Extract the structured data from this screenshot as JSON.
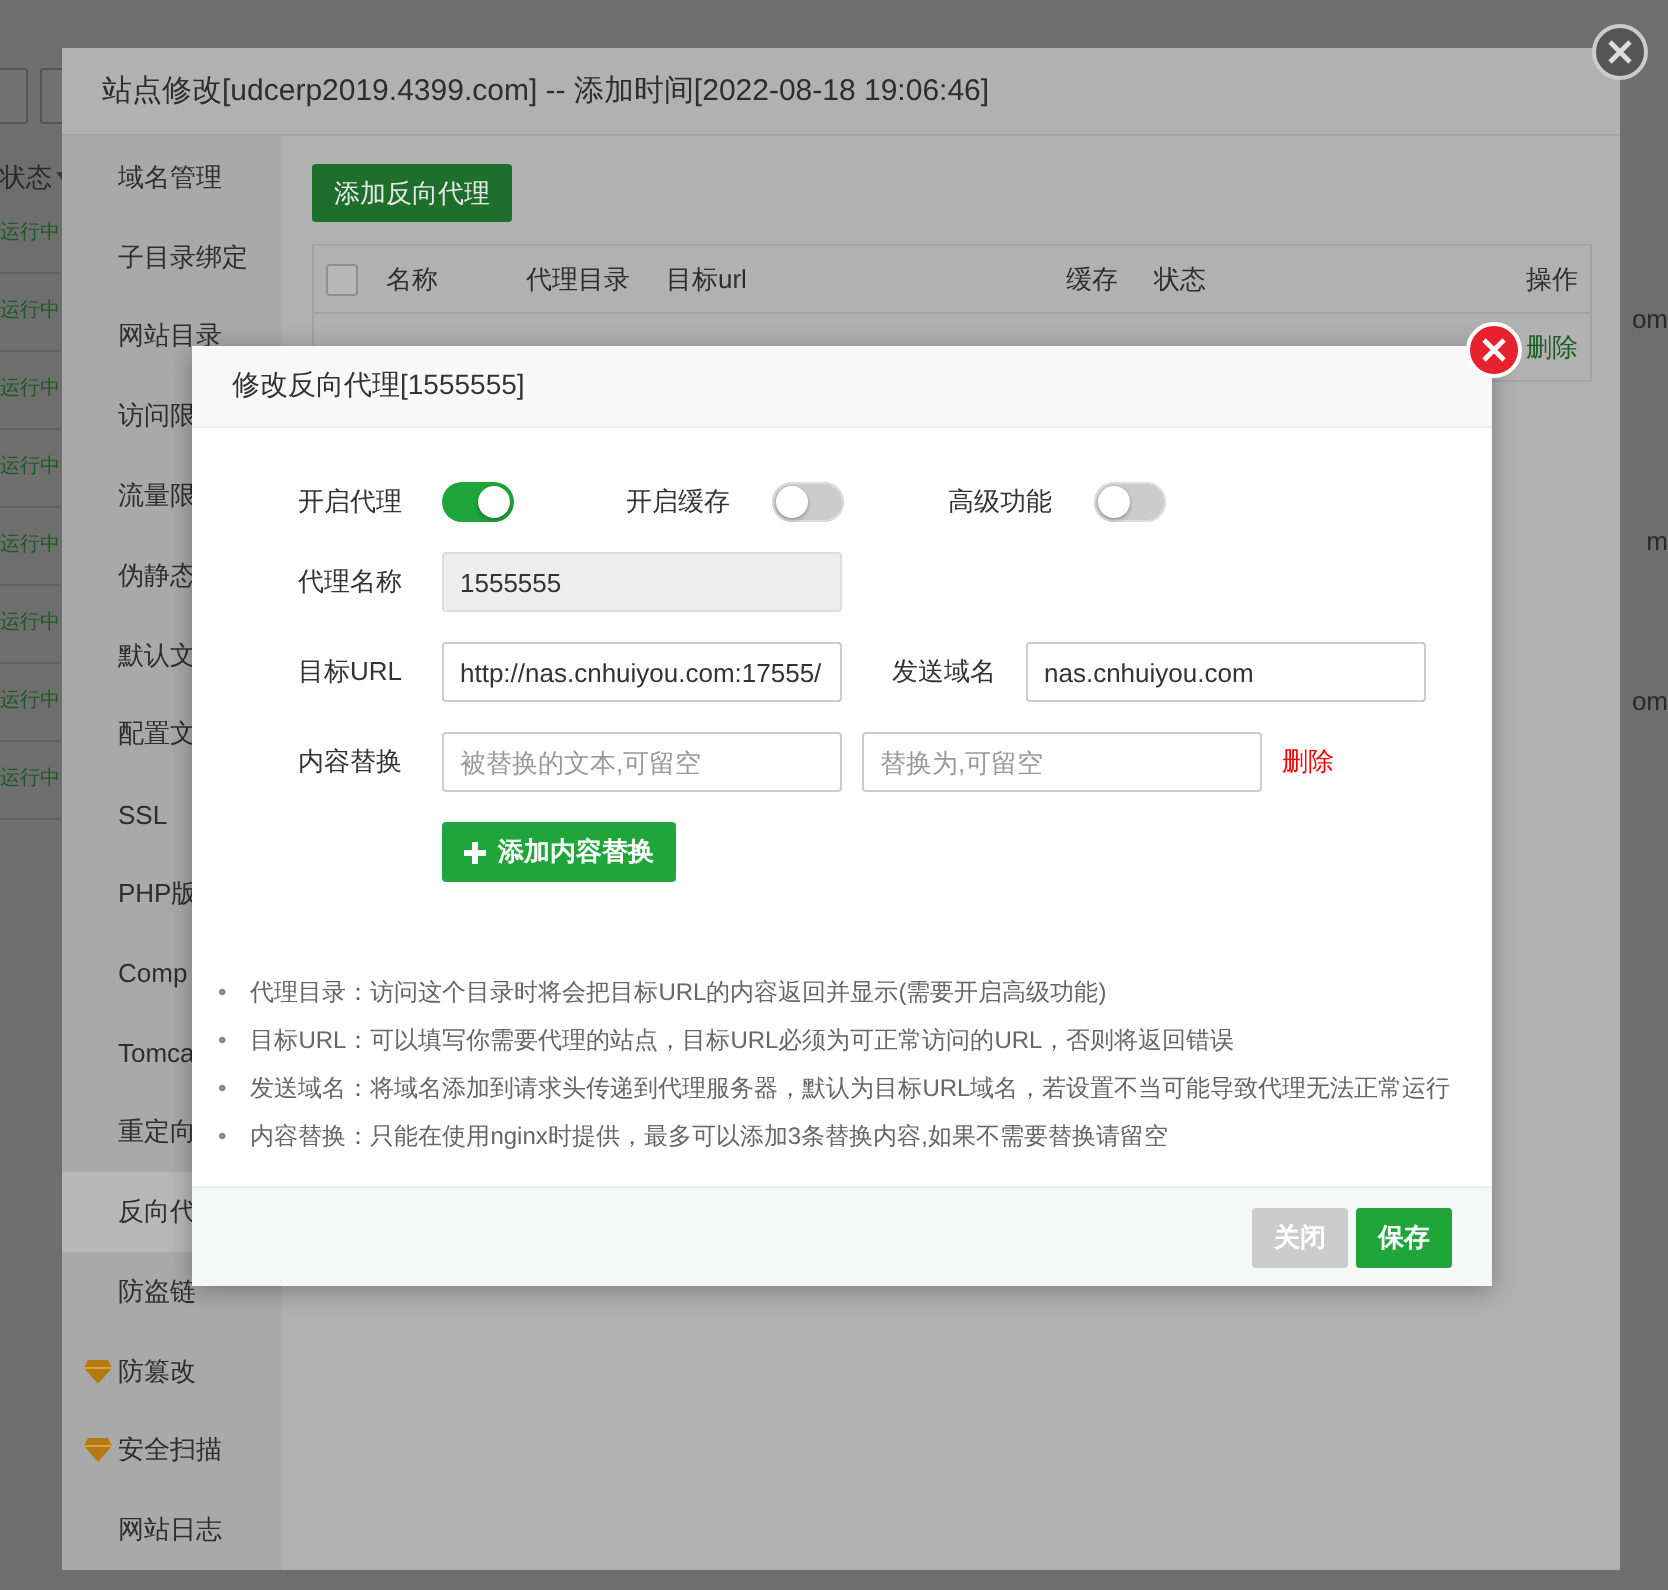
{
  "background": {
    "column_header": "状态",
    "rows": [
      "运行中",
      "运行中",
      "运行中",
      "运行中",
      "运行中",
      "运行中",
      "运行中",
      "运行中"
    ],
    "right_fragments": [
      "om",
      "m",
      "om"
    ]
  },
  "site_dialog": {
    "title": "站点修改[udcerp2019.4399.com] -- 添加时间[2022-08-18 19:06:46]",
    "sidebar": [
      {
        "label": "域名管理",
        "premium": false,
        "selected": false
      },
      {
        "label": "子目录绑定",
        "premium": false,
        "selected": false
      },
      {
        "label": "网站目录",
        "premium": false,
        "selected": false
      },
      {
        "label": "访问限",
        "premium": false,
        "selected": false
      },
      {
        "label": "流量限",
        "premium": false,
        "selected": false
      },
      {
        "label": "伪静态",
        "premium": false,
        "selected": false
      },
      {
        "label": "默认文",
        "premium": false,
        "selected": false
      },
      {
        "label": "配置文",
        "premium": false,
        "selected": false
      },
      {
        "label": "SSL",
        "premium": false,
        "selected": false
      },
      {
        "label": "PHP版",
        "premium": false,
        "selected": false
      },
      {
        "label": "Comp",
        "premium": false,
        "selected": false
      },
      {
        "label": "Tomca",
        "premium": false,
        "selected": false
      },
      {
        "label": "重定向",
        "premium": false,
        "selected": false
      },
      {
        "label": "反向代",
        "premium": false,
        "selected": true
      },
      {
        "label": "防盗链",
        "premium": false,
        "selected": false
      },
      {
        "label": "防篡改",
        "premium": true,
        "selected": false
      },
      {
        "label": "安全扫描",
        "premium": true,
        "selected": false
      },
      {
        "label": "网站日志",
        "premium": false,
        "selected": false
      }
    ],
    "add_button": "添加反向代理",
    "table": {
      "all_checked": false,
      "columns": [
        "名称",
        "代理目录",
        "目标url",
        "缓存",
        "状态",
        "操作"
      ],
      "rows": [
        {
          "action": "删除"
        }
      ]
    }
  },
  "proxy_dialog": {
    "title": "修改反向代理[1555555]",
    "toggles": [
      {
        "label": "开启代理",
        "on": true
      },
      {
        "label": "开启缓存",
        "on": false
      },
      {
        "label": "高级功能",
        "on": false
      }
    ],
    "name": {
      "label": "代理名称",
      "value": "1555555",
      "disabled": true
    },
    "target_url": {
      "label": "目标URL",
      "value": "http://nas.cnhuiyou.com:17555/"
    },
    "send_domain": {
      "label": "发送域名",
      "value": "nas.cnhuiyou.com"
    },
    "content_replace": {
      "label": "内容替换",
      "from_placeholder": "被替换的文本,可留空",
      "to_placeholder": "替换为,可留空",
      "delete": "删除"
    },
    "add_replace_button": "添加内容替换",
    "notes": [
      {
        "bullet": "•",
        "text": "代理目录：访问这个目录时将会把目标URL的内容返回并显示(需要开启高级功能)"
      },
      {
        "bullet": "•",
        "text": "目标URL：可以填写你需要代理的站点，目标URL必须为可正常访问的URL，否则将返回错误"
      },
      {
        "bullet": "•",
        "text": "发送域名：将域名添加到请求头传递到代理服务器，默认为目标URL域名，若设置不当可能导致代理无法正常运行"
      },
      {
        "bullet": "•",
        "text": "内容替换：只能在使用nginx时提供，最多可以添加3条替换内容,如果不需要替换请留空"
      }
    ],
    "buttons": [
      {
        "label": "关闭",
        "kind": "secondary"
      },
      {
        "label": "保存",
        "kind": "primary"
      }
    ]
  }
}
